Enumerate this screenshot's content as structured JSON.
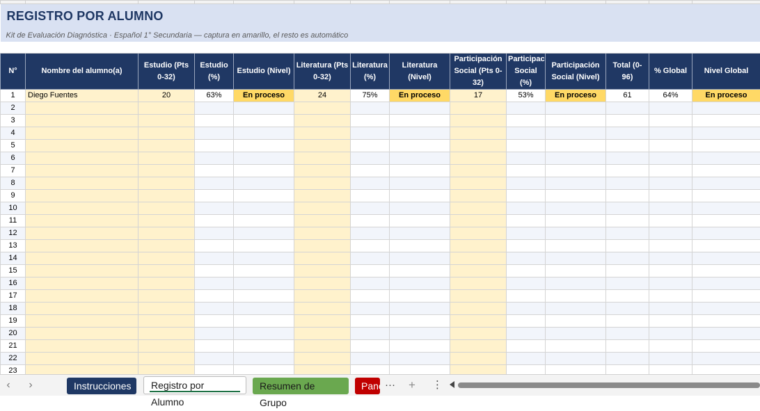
{
  "sheet": {
    "title": "REGISTRO POR ALUMNO",
    "subtitle": "Kit de Evaluación Diagnóstica · Español 1° Secundaria — captura en amarillo, el resto es automático",
    "headers": [
      "N°",
      "Nombre del alumno(a)",
      "Estudio (Pts 0-32)",
      "Estudio (%)",
      "Estudio (Nivel)",
      "Literatura (Pts 0-32)",
      "Literatura (%)",
      "Literatura (Nivel)",
      "Participación Social (Pts 0-32)",
      "Participación Social (%)",
      "Participación Social (Nivel)",
      "Total (0-96)",
      "% Global",
      "Nivel Global"
    ],
    "rows": [
      [
        "1",
        "Diego Fuentes",
        "20",
        "63%",
        "En proceso",
        "24",
        "75%",
        "En proceso",
        "17",
        "53%",
        "En proceso",
        "61",
        "64%",
        "En proceso"
      ],
      [
        "2"
      ],
      [
        "3"
      ],
      [
        "4"
      ],
      [
        "5"
      ],
      [
        "6"
      ],
      [
        "7"
      ],
      [
        "8"
      ],
      [
        "9"
      ],
      [
        "10"
      ],
      [
        "11"
      ],
      [
        "12"
      ],
      [
        "13"
      ],
      [
        "14"
      ],
      [
        "15"
      ],
      [
        "16"
      ],
      [
        "17"
      ],
      [
        "18"
      ],
      [
        "19"
      ],
      [
        "20"
      ],
      [
        "21"
      ],
      [
        "22"
      ],
      [
        "23"
      ]
    ]
  },
  "tabs": {
    "prev_icon": "‹",
    "next_icon": "›",
    "instrucciones": "Instrucciones",
    "registro": "Registro por Alumno",
    "resumen": "Resumen de Grupo",
    "panel": "Panel",
    "more_tabs": "···",
    "add_sheet": "+",
    "options": "⋮"
  },
  "colors": {
    "header_bg": "#203864",
    "title_band": "#d9e1f2",
    "input_yellow": "#fff2cc",
    "level_yellow": "#ffd966",
    "tab_instr": "#1f3864",
    "tab_resumen": "#6aa84f",
    "tab_panel": "#c00000"
  }
}
